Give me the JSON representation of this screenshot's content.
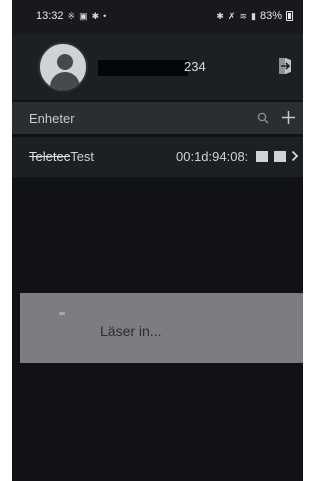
{
  "status_bar": {
    "time": "13:32",
    "left_icons": [
      "alert-icon",
      "message-icon",
      "app-icon"
    ],
    "right_icons": [
      "bluetooth-icon",
      "mute-icon",
      "wifi-icon",
      "signal-icon"
    ],
    "dot": "•",
    "battery": "83%"
  },
  "header": {
    "user_number": "234"
  },
  "section": {
    "title": "Enheter"
  },
  "device": {
    "name_prefix": "Teletec",
    "name": "Test",
    "mac": "00:1d:94:08:"
  },
  "loading": {
    "text": "Läser in..."
  },
  "colors": {
    "background": "#101216",
    "header": "#1c1f23",
    "section_header": "#2a2d31",
    "overlay": "#7b7d80"
  }
}
